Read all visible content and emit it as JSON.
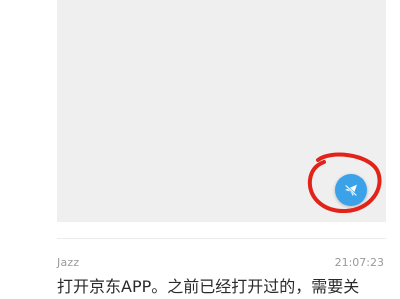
{
  "comment": {
    "author": "Jazz",
    "time": "21:07:23",
    "text": "打开京东APP。之前已经打开过的，需要关"
  },
  "media": {
    "fab_icon": "send-off-icon",
    "fab_color": "#3ba2ea",
    "annotation_color": "#e2231a"
  }
}
